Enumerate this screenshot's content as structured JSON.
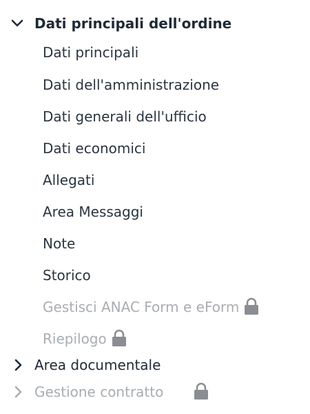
{
  "sections": [
    {
      "label": "Dati principali dell'ordine",
      "expanded": true,
      "items": [
        {
          "label": "Dati principali",
          "enabled": true
        },
        {
          "label": "Dati dell'amministrazione",
          "enabled": true
        },
        {
          "label": "Dati generali dell'ufficio",
          "enabled": true
        },
        {
          "label": "Dati economici",
          "enabled": true
        },
        {
          "label": "Allegati",
          "enabled": true
        },
        {
          "label": "Area Messaggi",
          "enabled": true
        },
        {
          "label": "Note",
          "enabled": true
        },
        {
          "label": "Storico",
          "enabled": true
        },
        {
          "label": "Gestisci ANAC Form e eForm",
          "enabled": false,
          "icon": "lock-icon"
        },
        {
          "label": "Riepilogo",
          "enabled": false,
          "icon": "lock-icon"
        }
      ]
    },
    {
      "label": "Area documentale",
      "expanded": false
    },
    {
      "label": "Gestione contratto",
      "expanded": false,
      "enabled": false,
      "icon": "lock-icon"
    }
  ],
  "colors": {
    "text": "#1f2a36",
    "disabled": "#a9adb2",
    "lock": "#8a8e93"
  }
}
